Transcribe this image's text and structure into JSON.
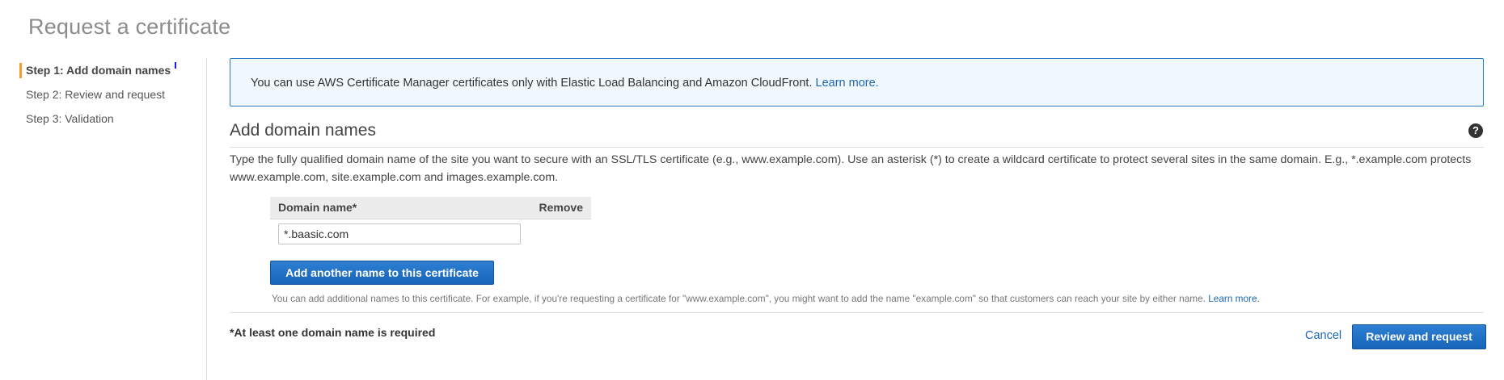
{
  "page": {
    "title": "Request a certificate"
  },
  "steps": [
    {
      "label": "Step 1: Add domain names",
      "active": true
    },
    {
      "label": "Step 2: Review and request",
      "active": false
    },
    {
      "label": "Step 3: Validation",
      "active": false
    }
  ],
  "info": {
    "text": "You can use AWS Certificate Manager certificates only with Elastic Load Balancing and Amazon CloudFront.",
    "link": "Learn more."
  },
  "section": {
    "title": "Add domain names",
    "help_icon": "question-circle-icon",
    "description": "Type the fully qualified domain name of the site you want to secure with an SSL/TLS certificate (e.g., www.example.com). Use an asterisk (*) to create a wildcard certificate to protect several sites in the same domain. E.g., *.example.com protects www.example.com, site.example.com and images.example.com."
  },
  "domain_table": {
    "col_domain": "Domain name*",
    "col_remove": "Remove",
    "rows": [
      {
        "value": "*.baasic.com"
      }
    ]
  },
  "add_button": "Add another name to this certificate",
  "hint": {
    "text": "You can add additional names to this certificate. For example, if you're requesting a certificate for \"www.example.com\", you might want to add the name \"example.com\" so that customers can reach your site by either name.",
    "link": "Learn more."
  },
  "footer": {
    "required_note": "*At least one domain name is required",
    "cancel": "Cancel",
    "review_button": "Review and request"
  },
  "colors": {
    "accent_orange": "#f0a02a",
    "link_blue": "#1b66b3",
    "primary_button": "#1765b8",
    "info_border": "#2a7bbf",
    "info_background": "#f1f8fd"
  }
}
